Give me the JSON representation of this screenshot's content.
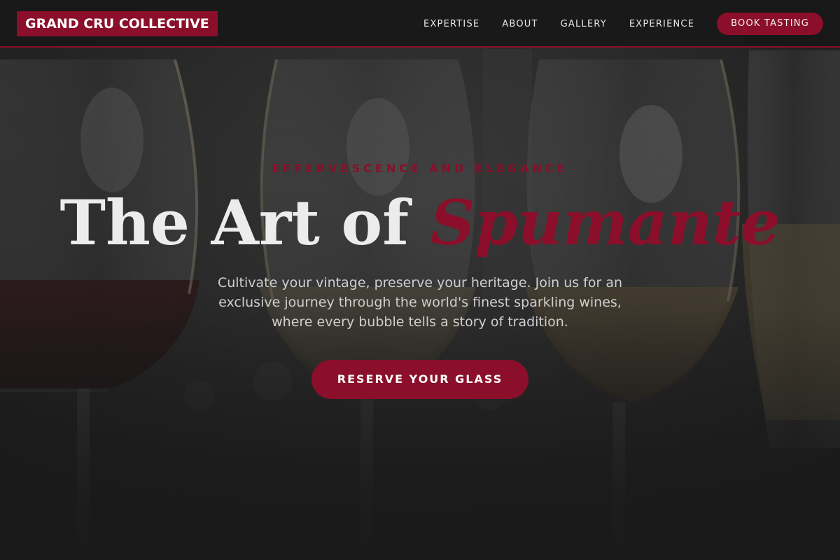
{
  "brand": {
    "name": "GRAND CRU COLLECTIVE"
  },
  "nav": {
    "items": [
      {
        "label": "EXPERTISE"
      },
      {
        "label": "ABOUT"
      },
      {
        "label": "GALLERY"
      },
      {
        "label": "EXPERIENCE"
      }
    ],
    "cta_label": "BOOK TASTING"
  },
  "hero": {
    "eyebrow": "EFFERVESCENCE AND ELEGANCE",
    "title_main": "The Art of ",
    "title_accent": "Spumante",
    "subtitle": "Cultivate your vintage, preserve your heritage. Join us for an exclusive journey through the world's finest sparkling wines, where every bubble tells a story of tradition.",
    "cta_label": "RESERVE YOUR GLASS"
  },
  "colors": {
    "accent": "#8b0f2a",
    "background": "#1a1a1a",
    "text": "#ececec"
  },
  "icons": [
    "wine-glasses-photo"
  ]
}
